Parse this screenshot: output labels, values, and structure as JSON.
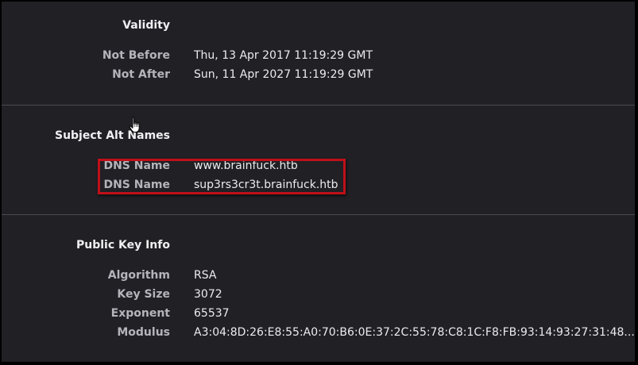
{
  "validity": {
    "title": "Validity",
    "rows": [
      {
        "label": "Not Before",
        "value": "Thu, 13 Apr 2017 11:19:29 GMT"
      },
      {
        "label": "Not After",
        "value": "Sun, 11 Apr 2027 11:19:29 GMT"
      }
    ]
  },
  "subject_alt_names": {
    "title": "Subject Alt Names",
    "rows": [
      {
        "label": "DNS Name",
        "value": "www.brainfuck.htb"
      },
      {
        "label": "DNS Name",
        "value": "sup3rs3cr3t.brainfuck.htb"
      }
    ],
    "highlight_color": "#c01018"
  },
  "public_key_info": {
    "title": "Public Key Info",
    "rows": [
      {
        "label": "Algorithm",
        "value": "RSA"
      },
      {
        "label": "Key Size",
        "value": "3072"
      },
      {
        "label": "Exponent",
        "value": "65537"
      },
      {
        "label": "Modulus",
        "value": "A3:04:8D:26:E8:55:A0:70:B6:0E:37:2C:55:78:C8:1C:F8:FB:93:14:93:27:31:48..."
      }
    ]
  },
  "cursor": {
    "icon": "hand-pointer-icon"
  }
}
